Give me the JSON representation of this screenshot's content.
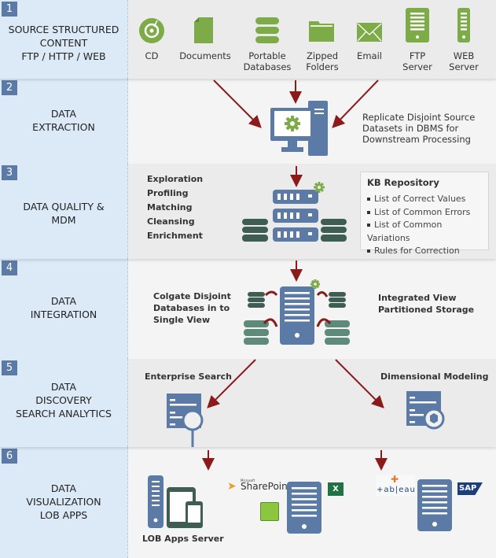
{
  "colors": {
    "stage_bg": "#dce9f7",
    "badge": "#5b7ba6",
    "icon_green": "#7cab48",
    "icon_blue": "#5b7ba6",
    "db_dark": "#3f5e53",
    "db_light": "#5e8a7a",
    "arrow": "#8b1a1a"
  },
  "stages": [
    {
      "number": "1",
      "label_lines": [
        "SOURCE STRUCTURED",
        "CONTENT",
        "FTP / HTTP / WEB"
      ]
    },
    {
      "number": "2",
      "label_lines": [
        "DATA",
        "EXTRACTION"
      ]
    },
    {
      "number": "3",
      "label_lines": [
        "DATA QUALITY &",
        "MDM"
      ]
    },
    {
      "number": "4",
      "label_lines": [
        "DATA",
        "INTEGRATION"
      ]
    },
    {
      "number": "5",
      "label_lines": [
        "DATA",
        "DISCOVERY",
        "SEARCH ANALYTICS"
      ]
    },
    {
      "number": "6",
      "label_lines": [
        "DATA",
        "VISUALIZATION",
        "LOB APPS"
      ]
    }
  ],
  "sources": [
    {
      "icon": "cd-icon",
      "label_lines": [
        "CD"
      ]
    },
    {
      "icon": "document-icon",
      "label_lines": [
        "Documents"
      ]
    },
    {
      "icon": "database-icon",
      "label_lines": [
        "Portable",
        "Databases"
      ]
    },
    {
      "icon": "folder-icon",
      "label_lines": [
        "Zipped",
        "Folders"
      ]
    },
    {
      "icon": "email-icon",
      "label_lines": [
        "Email"
      ]
    },
    {
      "icon": "ftp-server-icon",
      "label_lines": [
        "FTP",
        "Server"
      ]
    },
    {
      "icon": "web-server-icon",
      "label_lines": [
        "WEB",
        "Server"
      ]
    }
  ],
  "extraction": {
    "description_lines": [
      "Replicate Disjoint Source",
      "Datasets in DBMS for",
      "Downstream Processing"
    ]
  },
  "quality": {
    "steps": [
      "Exploration",
      "Profiling",
      "Matching",
      "Cleansing",
      "Enrichment"
    ],
    "kb": {
      "title": "KB Repository",
      "items": [
        "List of Correct Values",
        "List of Common Errors",
        "List of Common Variations",
        "Rules for Correction"
      ]
    }
  },
  "integration": {
    "left_lines": [
      "Colgate Disjoint",
      "Databases in to",
      "Single View"
    ],
    "right_lines": [
      "Integrated View",
      "Partitioned Storage"
    ]
  },
  "discovery": {
    "left": "Enterprise Search",
    "right": "Dimensional Modeling"
  },
  "visualization": {
    "lob_label": "LOB Apps Server",
    "logos": {
      "sharepoint_small": "Microsoft",
      "sharepoint": "SharePoint",
      "excel": "X",
      "tableau": "+ab|eau",
      "sap": "SAP"
    }
  }
}
